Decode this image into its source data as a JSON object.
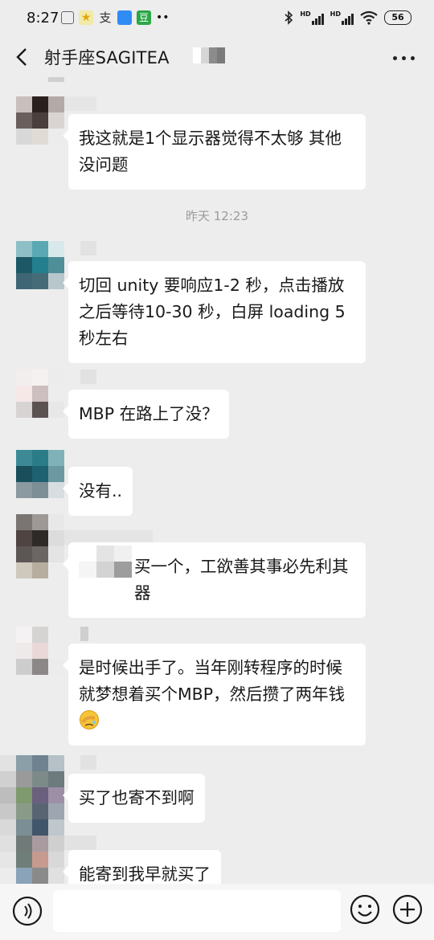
{
  "status_bar": {
    "time": "8:27",
    "network_1": "HD",
    "network_2": "HD",
    "battery": "56"
  },
  "header": {
    "title": "射手座SAGITEA"
  },
  "messages": [
    {
      "type": "text",
      "text": "我这就是1个显示器觉得不太够  其他没问题"
    },
    {
      "type": "time",
      "text": "昨天 12:23"
    },
    {
      "type": "text",
      "text": "切回 unity 要响应1-2 秒，点击播放之后等待10-30 秒，白屏 loading 5 秒左右"
    },
    {
      "type": "text",
      "text": "MBP 在路上了没？"
    },
    {
      "type": "text",
      "text": "没有.."
    },
    {
      "type": "text",
      "text": "买一个，工欲善其事必先利其器"
    },
    {
      "type": "text",
      "text": "是时候出手了。当年刚转程序的时候就梦想着买个MBP，然后攒了两年钱"
    },
    {
      "type": "text",
      "text": "买了也寄不到啊"
    },
    {
      "type": "text",
      "text": "能寄到我早就买了"
    }
  ],
  "icons": {
    "back": "chevron-left-icon",
    "more": "more-icon",
    "voice": "voice-icon",
    "emoji": "emoji-icon",
    "add": "add-icon",
    "message_emoji": "facepalm-emoji"
  },
  "colors": {
    "background": "#ededed",
    "bubble": "#ffffff",
    "timestamp": "#9b9b9b"
  }
}
